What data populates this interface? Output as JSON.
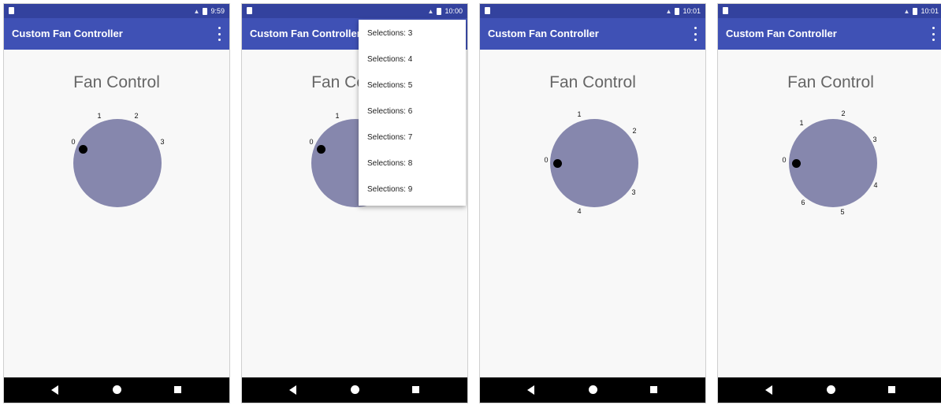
{
  "screens": [
    {
      "status_time": "9:59",
      "app_title": "Custom Fan Controller",
      "heading": "Fan Control",
      "labels": [
        "0",
        "1",
        "2",
        "3"
      ]
    },
    {
      "status_time": "10:00",
      "app_title": "Custom Fan Controller",
      "heading": "Fan Control",
      "labels": [
        "0",
        "1"
      ],
      "menu": [
        "Selections: 3",
        "Selections: 4",
        "Selections: 5",
        "Selections: 6",
        "Selections: 7",
        "Selections: 8",
        "Selections: 9"
      ]
    },
    {
      "status_time": "10:01",
      "app_title": "Custom Fan Controller",
      "heading": "Fan Control",
      "labels": [
        "0",
        "1",
        "2",
        "3",
        "4"
      ]
    },
    {
      "status_time": "10:01",
      "app_title": "Custom Fan Controller",
      "heading": "Fan Control",
      "labels": [
        "0",
        "1",
        "2",
        "3",
        "4",
        "5",
        "6"
      ]
    }
  ],
  "icons": {
    "status_left": "sim-card-icon",
    "signal": "signal-icon",
    "battery": "battery-icon",
    "overflow": "more-vert-icon",
    "back": "back-triangle-icon",
    "home": "home-circle-icon",
    "recents": "recents-square-icon"
  },
  "colors": {
    "status_bar": "#33429e",
    "app_bar": "#3f51b5",
    "dial": "#8687ad",
    "indicator": "#000000",
    "background": "#f8f8f8",
    "nav_bar": "#000000"
  }
}
